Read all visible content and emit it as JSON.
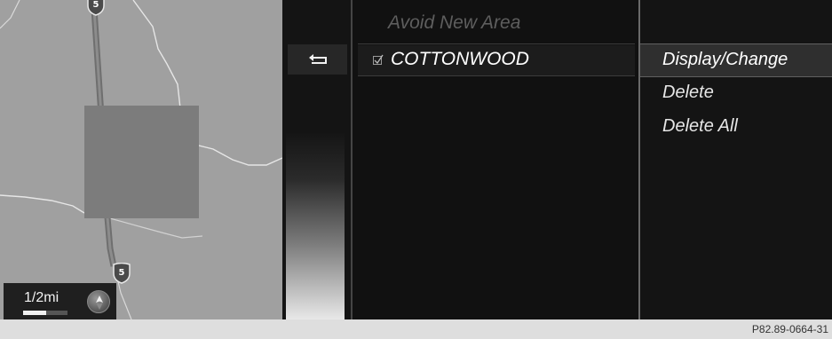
{
  "map": {
    "route_shields": [
      "5",
      "5"
    ],
    "scale": {
      "label": "1/2mi",
      "fill_fraction": 0.52
    }
  },
  "list": {
    "header": "Avoid New Area",
    "items": [
      {
        "label": "COTTONWOOD",
        "checked": true
      }
    ]
  },
  "menu": {
    "items": [
      "Display/Change",
      "Delete",
      "Delete All"
    ],
    "selected": "Display/Change"
  },
  "icons": {
    "back": "back-arrow-icon",
    "compass": "compass-icon",
    "checkbox": "checkbox-icon",
    "shield": "interstate-shield-icon"
  },
  "caption": "P82.89-0664-31",
  "colors": {
    "map_background": "#a0a0a0",
    "avoid_area": "#7c7c7c",
    "screen_background": "#141414",
    "highlight": "#2f2f2f",
    "text_primary": "#ffffff",
    "text_disabled": "#5e5e5e"
  }
}
